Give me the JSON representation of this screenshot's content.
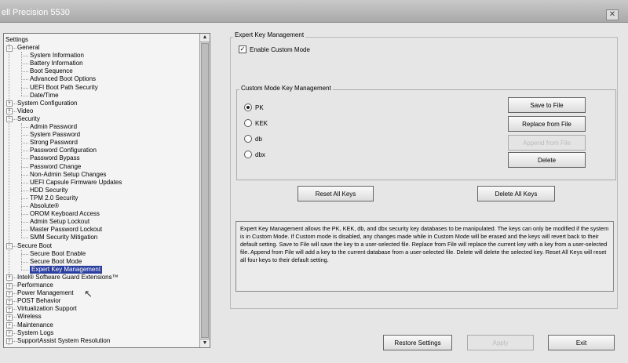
{
  "window": {
    "title": "ell Precision 5530",
    "close_glyph": "✕"
  },
  "tree": {
    "root": "Settings",
    "items": [
      {
        "label": "General",
        "level": 1,
        "expander": "−"
      },
      {
        "label": "System Information",
        "level": 2
      },
      {
        "label": "Battery Information",
        "level": 2
      },
      {
        "label": "Boot Sequence",
        "level": 2
      },
      {
        "label": "Advanced Boot Options",
        "level": 2
      },
      {
        "label": "UEFI Boot Path Security",
        "level": 2
      },
      {
        "label": "Date/Time",
        "level": 2
      },
      {
        "label": "System Configuration",
        "level": 1,
        "expander": "+"
      },
      {
        "label": "Video",
        "level": 1,
        "expander": "+"
      },
      {
        "label": "Security",
        "level": 1,
        "expander": "−"
      },
      {
        "label": "Admin Password",
        "level": 2
      },
      {
        "label": "System Password",
        "level": 2
      },
      {
        "label": "Strong Password",
        "level": 2
      },
      {
        "label": "Password Configuration",
        "level": 2
      },
      {
        "label": "Password Bypass",
        "level": 2
      },
      {
        "label": "Password Change",
        "level": 2
      },
      {
        "label": "Non-Admin Setup Changes",
        "level": 2
      },
      {
        "label": "UEFI Capsule Firmware Updates",
        "level": 2
      },
      {
        "label": "HDD Security",
        "level": 2
      },
      {
        "label": "TPM 2.0 Security",
        "level": 2
      },
      {
        "label": "Absolute®",
        "level": 2
      },
      {
        "label": "OROM Keyboard Access",
        "level": 2
      },
      {
        "label": "Admin Setup Lockout",
        "level": 2
      },
      {
        "label": "Master Password Lockout",
        "level": 2
      },
      {
        "label": "SMM Security Mitigation",
        "level": 2
      },
      {
        "label": "Secure Boot",
        "level": 1,
        "expander": "−"
      },
      {
        "label": "Secure Boot Enable",
        "level": 2
      },
      {
        "label": "Secure Boot Mode",
        "level": 2
      },
      {
        "label": "Expert Key Management",
        "level": 2,
        "selected": true
      },
      {
        "label": "Intel® Software Guard Extensions™",
        "level": 1,
        "expander": "+"
      },
      {
        "label": "Performance",
        "level": 1,
        "expander": "+"
      },
      {
        "label": "Power Management",
        "level": 1,
        "expander": "+"
      },
      {
        "label": "POST Behavior",
        "level": 1,
        "expander": "+"
      },
      {
        "label": "Virtualization Support",
        "level": 1,
        "expander": "+"
      },
      {
        "label": "Wireless",
        "level": 1,
        "expander": "+"
      },
      {
        "label": "Maintenance",
        "level": 1,
        "expander": "+"
      },
      {
        "label": "System Logs",
        "level": 1,
        "expander": "+"
      },
      {
        "label": "SupportAssist System Resolution",
        "level": 1,
        "expander": "+"
      }
    ]
  },
  "expert": {
    "group_title": "Expert Key Management",
    "enable_custom_mode": {
      "label": "Enable Custom Mode",
      "checked": true,
      "mark": "✓"
    },
    "custom_group_title": "Custom Mode Key Management",
    "radios": [
      {
        "label": "PK",
        "selected": true
      },
      {
        "label": "KEK",
        "selected": false
      },
      {
        "label": "db",
        "selected": false
      },
      {
        "label": "dbx",
        "selected": false
      }
    ],
    "buttons": {
      "save_to_file": "Save to File",
      "replace_from_file": "Replace from File",
      "append_from_file": "Append from File",
      "delete": "Delete",
      "reset_all_keys": "Reset All Keys",
      "delete_all_keys": "Delete All Keys"
    },
    "description": "Expert Key Management allows the PK, KEK, db, and dbx security key databases to be manipulated. The keys can only be modified if the system is in Custom Mode. If Custom mode is disabled, any changes made while in Custom Mode will be erased and the keys will revert back to their default setting. Save to File will save the key to a user-selected file. Replace from File will replace the current key with a key from a user-selected file. Append from File will add a key to the current database from a user-selected file. Delete will delete the selected key. Reset All Keys will reset all four keys to their default setting."
  },
  "footer": {
    "restore_settings": "Restore Settings",
    "apply": "Apply",
    "exit": "Exit"
  }
}
